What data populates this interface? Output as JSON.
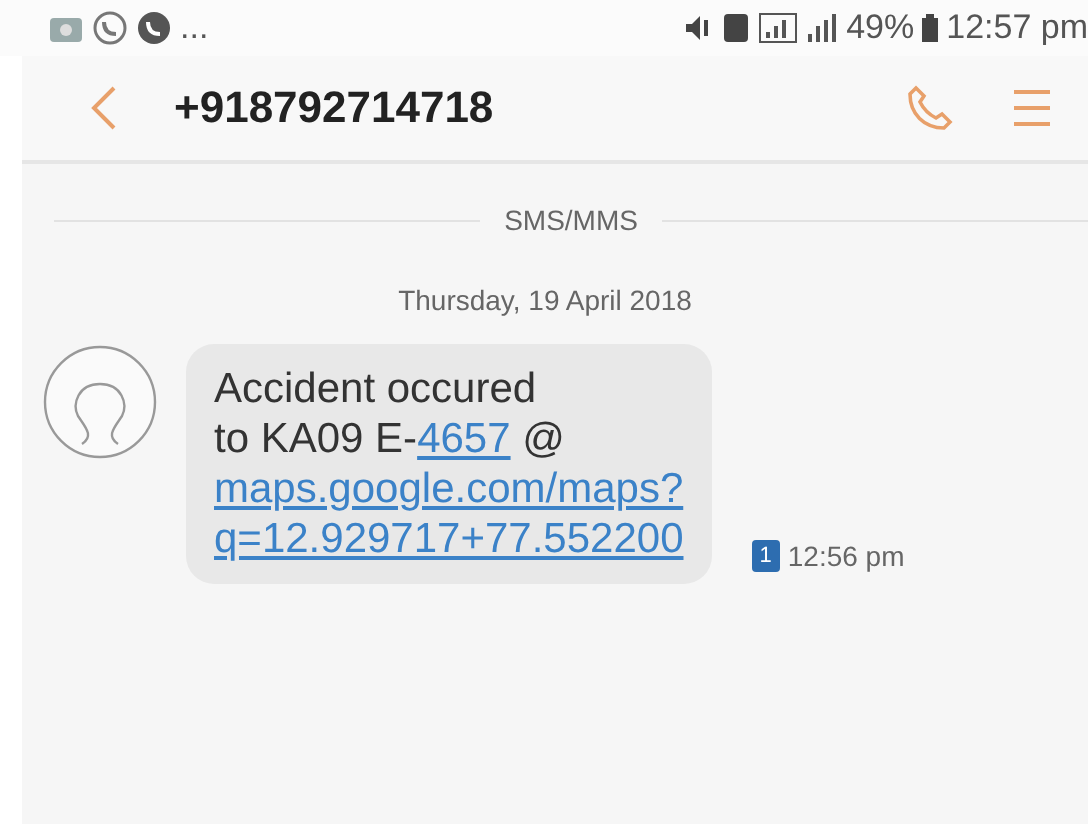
{
  "status_bar": {
    "more": "...",
    "battery": "49%",
    "time": "12:57 pm"
  },
  "header": {
    "title": "+918792714718"
  },
  "channel_label": "SMS/MMS",
  "date_label": "Thursday, 19 April 2018",
  "message": {
    "lines": [
      [
        {
          "text": "Accident occured",
          "kind": "text"
        }
      ],
      [
        {
          "text": "to KA09 E-",
          "kind": "text"
        },
        {
          "text": "4657",
          "kind": "link"
        },
        {
          "text": " @",
          "kind": "text"
        }
      ],
      [
        {
          "text": "maps.google.com/maps?",
          "kind": "link"
        }
      ],
      [
        {
          "text": "q=12.929717+77.552200",
          "kind": "link"
        }
      ]
    ],
    "sim": "1",
    "time": "12:56 pm"
  }
}
